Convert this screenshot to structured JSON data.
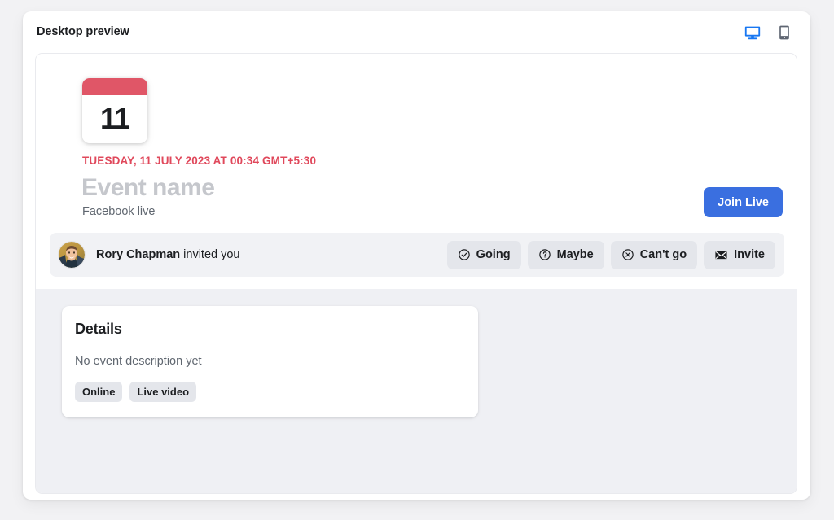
{
  "header": {
    "title": "Desktop preview",
    "devices": [
      {
        "name": "desktop-view-toggle",
        "icon": "monitor-icon",
        "active": true,
        "color": "#1877f2"
      },
      {
        "name": "mobile-view-toggle",
        "icon": "mobile-phone-icon",
        "active": false,
        "color": "#606770"
      }
    ]
  },
  "event": {
    "calendar": {
      "day": "11",
      "accent_color": "#e05667"
    },
    "datetime": "TUESDAY, 11 JULY 2023 AT 00:34 GMT+5:30",
    "datetime_color": "#e0485b",
    "name_placeholder": "Event name",
    "subtitle": "Facebook live",
    "join_button": {
      "label": "Join Live",
      "color": "#3a6fe0"
    },
    "invite": {
      "avatar_alt": "Rory Chapman avatar",
      "inviter": "Rory Chapman",
      "suffix": " invited you",
      "actions": [
        {
          "label": "Going",
          "icon": "check-circle-icon"
        },
        {
          "label": "Maybe",
          "icon": "question-circle-icon"
        },
        {
          "label": "Can't go",
          "icon": "x-circle-icon"
        },
        {
          "label": "Invite",
          "icon": "envelope-icon"
        }
      ]
    }
  },
  "details": {
    "title": "Details",
    "description": "No event description yet",
    "tags": [
      "Online",
      "Live video"
    ]
  }
}
